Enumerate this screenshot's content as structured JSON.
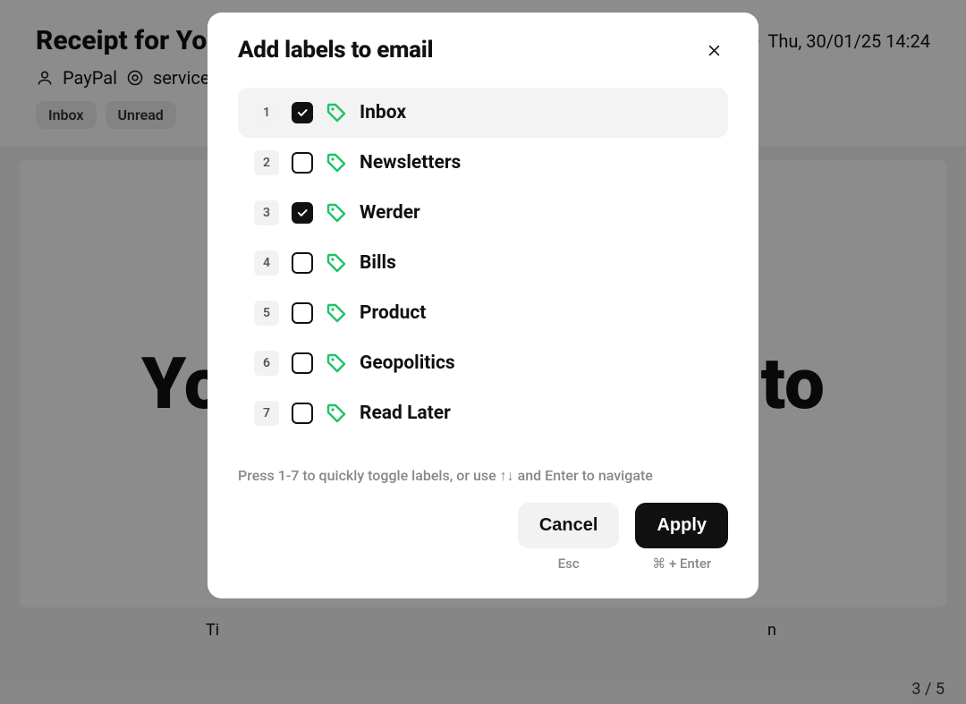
{
  "modal": {
    "title": "Add labels to email",
    "hint": "Press 1-7 to quickly toggle labels, or use ↑↓ and Enter to navigate",
    "labels": [
      {
        "num": "1",
        "name": "Inbox",
        "checked": true,
        "highlight": true
      },
      {
        "num": "2",
        "name": "Newsletters",
        "checked": false,
        "highlight": false
      },
      {
        "num": "3",
        "name": "Werder",
        "checked": true,
        "highlight": false
      },
      {
        "num": "4",
        "name": "Bills",
        "checked": false,
        "highlight": false
      },
      {
        "num": "5",
        "name": "Product",
        "checked": false,
        "highlight": false
      },
      {
        "num": "6",
        "name": "Geopolitics",
        "checked": false,
        "highlight": false
      },
      {
        "num": "7",
        "name": "Read Later",
        "checked": false,
        "highlight": false
      }
    ],
    "cancel_label": "Cancel",
    "cancel_shortcut": "Esc",
    "apply_label": "Apply",
    "apply_shortcut": "⌘ + Enter",
    "tag_color": "#1dc468"
  },
  "background": {
    "subject": "Receipt for Your",
    "from_name": "PayPal",
    "from_addr": "service@",
    "date": "Thu, 30/01/25 14:24",
    "labels": [
      "Inbox",
      "Unread"
    ],
    "body_fragment_left": "Yo",
    "body_fragment_right": "to",
    "action_left": "Ti",
    "action_right": "n",
    "pager": "3 / 5"
  }
}
